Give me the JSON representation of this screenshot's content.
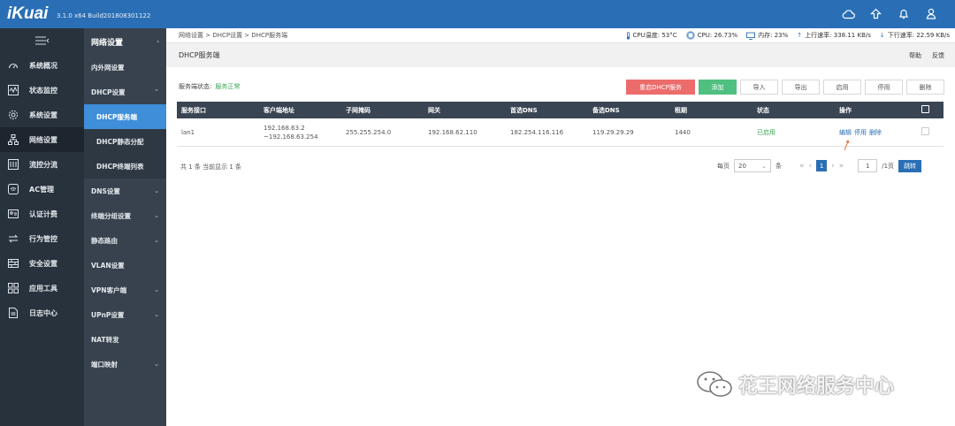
{
  "app": {
    "logo": "iKuai",
    "version": "3.1.0 x64 Build201808301122"
  },
  "top_icons": [
    "cloud-icon",
    "upload-icon",
    "bell-icon",
    "user-icon"
  ],
  "nav_main": [
    {
      "label": "系统概况",
      "icon": "dashboard-icon"
    },
    {
      "label": "状态监控",
      "icon": "monitor-icon"
    },
    {
      "label": "系统设置",
      "icon": "gear-icon"
    },
    {
      "label": "网络设置",
      "icon": "network-icon"
    },
    {
      "label": "流控分流",
      "icon": "flow-icon"
    },
    {
      "label": "AC管理",
      "icon": "wifi-icon"
    },
    {
      "label": "认证计费",
      "icon": "auth-icon"
    },
    {
      "label": "行为管控",
      "icon": "arrows-icon"
    },
    {
      "label": "安全设置",
      "icon": "wall-icon"
    },
    {
      "label": "应用工具",
      "icon": "apps-icon"
    },
    {
      "label": "日志中心",
      "icon": "log-icon"
    }
  ],
  "nav_sub": {
    "title": "网络设置",
    "items": [
      {
        "label": "内外网设置",
        "chevron": false
      },
      {
        "label": "DHCP设置",
        "chevron": true
      },
      {
        "label": "DHCP服务端",
        "chevron": false
      },
      {
        "label": "DHCP静态分配",
        "chevron": false
      },
      {
        "label": "DHCP终端列表",
        "chevron": false
      },
      {
        "label": "DNS设置",
        "chevron": true
      },
      {
        "label": "终端分组设置",
        "chevron": true
      },
      {
        "label": "静态路由",
        "chevron": true
      },
      {
        "label": "VLAN设置",
        "chevron": false
      },
      {
        "label": "VPN客户端",
        "chevron": true
      },
      {
        "label": "UPnP设置",
        "chevron": true
      },
      {
        "label": "NAT转发",
        "chevron": false
      },
      {
        "label": "端口映射",
        "chevron": true
      }
    ]
  },
  "breadcrumb": "网络设置 > DHCP设置 > DHCP服务端",
  "stats": {
    "cpu_temp": "CPU温度: 53°C",
    "cpu": "CPU: 26.73%",
    "mem": "内存: 23%",
    "up": "上行速率: 338.11 KB/s",
    "down": "下行速率: 22.59 KB/s"
  },
  "page_title": "DHCP服务端",
  "help": "帮助",
  "feedback": "反馈",
  "service_status_label": "服务端状态:",
  "service_status_value": "服务正常",
  "buttons": {
    "restart": "重启DHCP服务",
    "add": "添加",
    "import": "导入",
    "export": "导出",
    "enable": "启用",
    "disable": "停用",
    "delete": "删除"
  },
  "table": {
    "headers": [
      "服务接口",
      "客户端地址",
      "子网掩码",
      "网关",
      "首选DNS",
      "备选DNS",
      "租期",
      "状态",
      "操作"
    ],
    "rows": [
      {
        "iface": "lan1",
        "client_start": "192.168.63.2",
        "client_end": "~192.168.63.254",
        "mask": "255.255.254.0",
        "gateway": "192.168.62.110",
        "dns1": "182.254.116.116",
        "dns2": "119.29.29.29",
        "lease": "1440",
        "status": "已启用",
        "op_edit": "编辑",
        "op_disable": "停用",
        "op_delete": "删除"
      }
    ]
  },
  "summary": "共 1 条 当前显示 1 条",
  "pager": {
    "per_page_label": "每页",
    "per_page": "20",
    "unit": "条",
    "current": "1",
    "page_input": "1",
    "total": "/1页",
    "jump": "跳转"
  },
  "watermark": "花王网络服务中心"
}
